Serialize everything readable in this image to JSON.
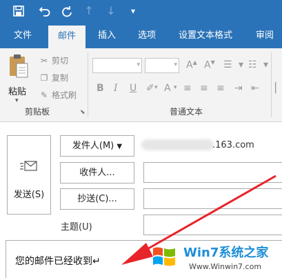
{
  "quick_access": {
    "icons": [
      "save-icon",
      "undo-icon",
      "redo-icon",
      "up-icon",
      "down-icon",
      "customize-icon"
    ]
  },
  "tabs": [
    {
      "label": "文件",
      "active": false
    },
    {
      "label": "邮件",
      "active": true
    },
    {
      "label": "插入",
      "active": false
    },
    {
      "label": "选项",
      "active": false
    },
    {
      "label": "设置文本格式",
      "active": false
    },
    {
      "label": "审阅",
      "active": false
    }
  ],
  "ribbon": {
    "clipboard": {
      "paste_label": "粘贴",
      "cut_label": "剪切",
      "copy_label": "复制",
      "format_painter_label": "格式刷",
      "group_label": "剪贴板"
    },
    "basic_text": {
      "group_label": "普通文本"
    }
  },
  "compose": {
    "send_label": "发送(S)",
    "from_button": "发件人(M)",
    "from_value": ".163.com",
    "to_button": "收件人...",
    "cc_button": "抄送(C)...",
    "subject_label": "主题(U)",
    "body_text": "您的邮件已经收到↵"
  },
  "watermark": {
    "title": "Win7系统之家",
    "url": "Www.Winwin7.com"
  },
  "colors": {
    "accent": "#2b73b8",
    "arrow": "#e8242b"
  }
}
